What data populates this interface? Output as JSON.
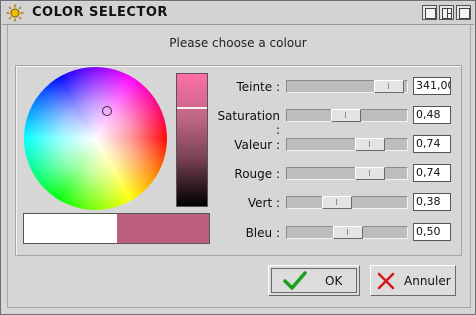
{
  "window": {
    "title": "COLOR SELECTOR"
  },
  "prompt": "Please choose a colour",
  "colors": {
    "preview_old": "#ffffff",
    "preview_new": "#bc5f7d"
  },
  "fields": [
    {
      "label": "Teinte :",
      "value": "341,00",
      "level": 0.95
    },
    {
      "label": "Saturation :",
      "value": "0,48",
      "level": 0.48
    },
    {
      "label": "Valeur :",
      "value": "0,74",
      "level": 0.74
    },
    {
      "label": "Rouge :",
      "value": "0,74",
      "level": 0.74
    },
    {
      "label": "Vert :",
      "value": "0,38",
      "level": 0.38
    },
    {
      "label": "Bleu :",
      "value": "0,50",
      "level": 0.5
    }
  ],
  "buttons": {
    "ok": "OK",
    "cancel": "Annuler"
  },
  "icons": {
    "app": "sun-icon",
    "ok": "checkmark-icon",
    "cancel": "cross-icon"
  }
}
